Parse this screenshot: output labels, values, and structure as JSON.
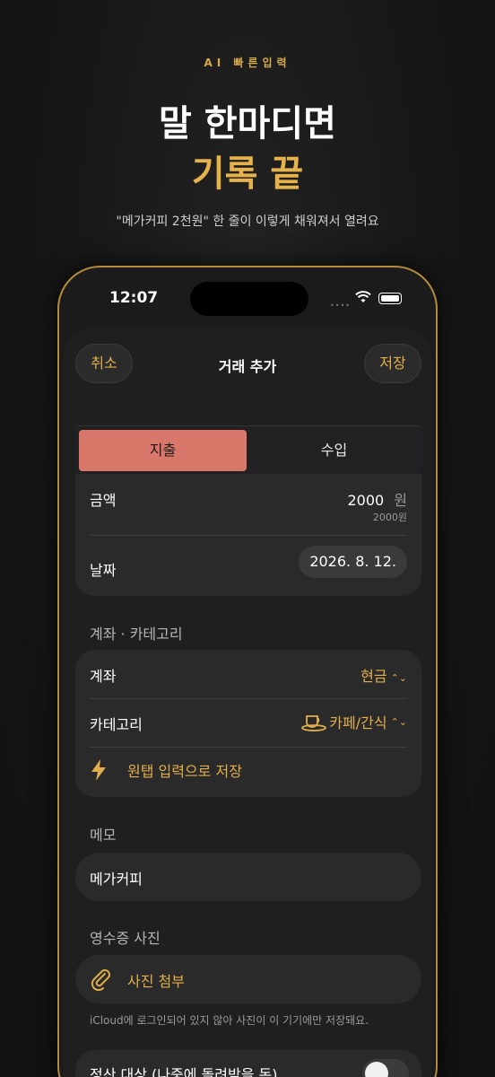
{
  "promo": {
    "eyebrow": "AI 빠른입력",
    "headline_line1": "말 한마디면",
    "headline_line2": "기록 끝",
    "subline": "\"메가커피 2천원\" 한 줄이 이렇게 채워져서 열려요"
  },
  "status_bar": {
    "time": "12:07"
  },
  "nav": {
    "cancel": "취소",
    "title": "거래 추가",
    "save": "저장"
  },
  "type_segment": {
    "expense": "지출",
    "income": "수입",
    "selected": "지출"
  },
  "amount_card": {
    "amount_label": "금액",
    "amount_value": "2000",
    "amount_unit": "원",
    "amount_preview": "2000원",
    "date_label": "날짜",
    "date_value": "2026. 8. 12."
  },
  "account_section": {
    "title": "계좌 · 카테고리",
    "account_label": "계좌",
    "account_value": "현금",
    "category_label": "카테고리",
    "category_value": "카페/간식",
    "quick_save": "원탭 입력으로 저장"
  },
  "memo_section": {
    "title": "메모",
    "value": "메가커피"
  },
  "receipt_section": {
    "title": "영수증 사진",
    "attach_label": "사진 첨부",
    "note": "iCloud에 로그인되어 있지 않아 사진이 이 기기에만 저장돼요."
  },
  "settlement": {
    "label": "정산 대상 (나중에 돌려받을 돈)"
  },
  "icons": {
    "quick_save": "lightning-icon",
    "attach": "paperclip-icon",
    "category": "coffee-cup-icon"
  },
  "colors": {
    "accent": "#e0ae4b",
    "expense": "#d9786a",
    "background": "#1f1f1f"
  }
}
